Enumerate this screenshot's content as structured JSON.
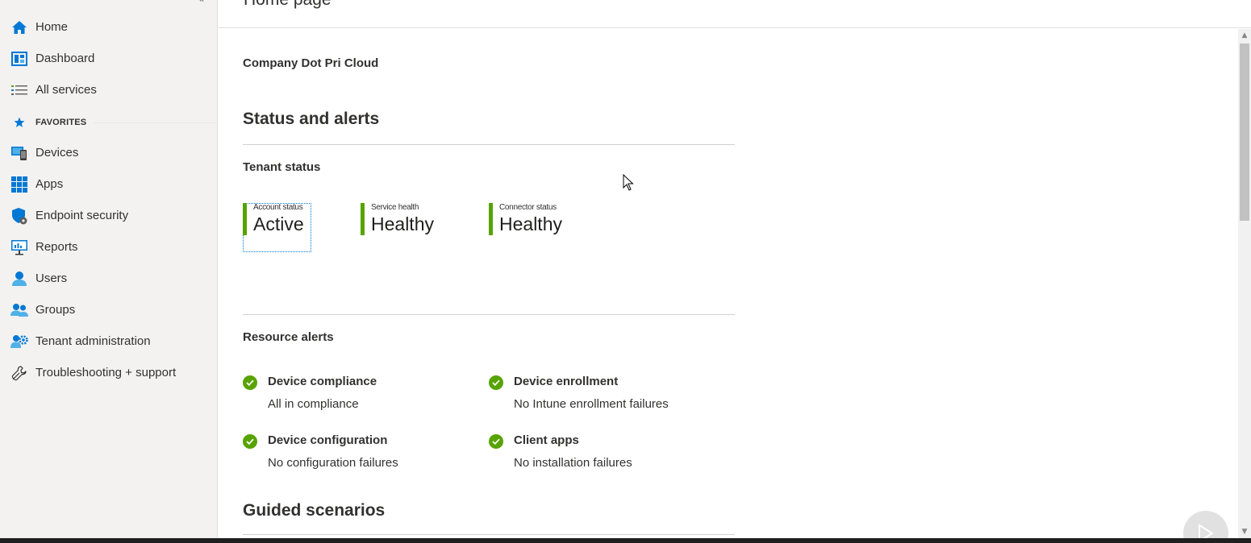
{
  "header": {
    "title": "Home page"
  },
  "sidebar": {
    "collapse_glyph": "«",
    "items": [
      {
        "label": "Home",
        "icon": "home-icon"
      },
      {
        "label": "Dashboard",
        "icon": "dashboard-icon"
      },
      {
        "label": "All services",
        "icon": "list-icon"
      },
      {
        "label": "Devices",
        "icon": "devices-icon"
      },
      {
        "label": "Apps",
        "icon": "apps-icon"
      },
      {
        "label": "Endpoint security",
        "icon": "shield-icon"
      },
      {
        "label": "Reports",
        "icon": "reports-icon"
      },
      {
        "label": "Users",
        "icon": "user-icon"
      },
      {
        "label": "Groups",
        "icon": "groups-icon"
      },
      {
        "label": "Tenant administration",
        "icon": "tenant-admin-icon"
      },
      {
        "label": "Troubleshooting + support",
        "icon": "wrench-icon"
      }
    ],
    "favorites_label": "FAVORITES"
  },
  "main": {
    "tenant_name": "Company Dot Pri Cloud",
    "status_section_title": "Status and alerts",
    "tenant_status_title": "Tenant status",
    "tiles": [
      {
        "label": "Account status",
        "value": "Active"
      },
      {
        "label": "Service health",
        "value": "Healthy"
      },
      {
        "label": "Connector status",
        "value": "Healthy"
      }
    ],
    "resource_alerts_title": "Resource alerts",
    "alerts": [
      {
        "title": "Device compliance",
        "desc": "All in compliance"
      },
      {
        "title": "Device enrollment",
        "desc": "No Intune enrollment failures"
      },
      {
        "title": "Device configuration",
        "desc": "No configuration failures"
      },
      {
        "title": "Client apps",
        "desc": "No installation failures"
      }
    ],
    "guided_title": "Guided scenarios"
  },
  "colors": {
    "accent": "#0078d4",
    "healthy_green": "#57a300",
    "sidebar_bg": "#f3f2f1"
  }
}
